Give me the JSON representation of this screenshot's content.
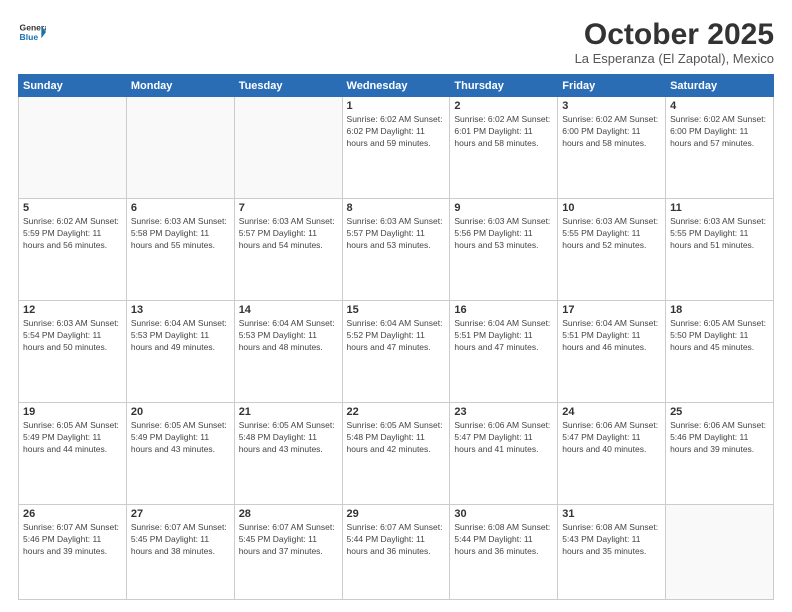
{
  "header": {
    "logo_line1": "General",
    "logo_line2": "Blue",
    "month": "October 2025",
    "location": "La Esperanza (El Zapotal), Mexico"
  },
  "days_of_week": [
    "Sunday",
    "Monday",
    "Tuesday",
    "Wednesday",
    "Thursday",
    "Friday",
    "Saturday"
  ],
  "weeks": [
    [
      {
        "day": "",
        "info": ""
      },
      {
        "day": "",
        "info": ""
      },
      {
        "day": "",
        "info": ""
      },
      {
        "day": "1",
        "info": "Sunrise: 6:02 AM\nSunset: 6:02 PM\nDaylight: 11 hours\nand 59 minutes."
      },
      {
        "day": "2",
        "info": "Sunrise: 6:02 AM\nSunset: 6:01 PM\nDaylight: 11 hours\nand 58 minutes."
      },
      {
        "day": "3",
        "info": "Sunrise: 6:02 AM\nSunset: 6:00 PM\nDaylight: 11 hours\nand 58 minutes."
      },
      {
        "day": "4",
        "info": "Sunrise: 6:02 AM\nSunset: 6:00 PM\nDaylight: 11 hours\nand 57 minutes."
      }
    ],
    [
      {
        "day": "5",
        "info": "Sunrise: 6:02 AM\nSunset: 5:59 PM\nDaylight: 11 hours\nand 56 minutes."
      },
      {
        "day": "6",
        "info": "Sunrise: 6:03 AM\nSunset: 5:58 PM\nDaylight: 11 hours\nand 55 minutes."
      },
      {
        "day": "7",
        "info": "Sunrise: 6:03 AM\nSunset: 5:57 PM\nDaylight: 11 hours\nand 54 minutes."
      },
      {
        "day": "8",
        "info": "Sunrise: 6:03 AM\nSunset: 5:57 PM\nDaylight: 11 hours\nand 53 minutes."
      },
      {
        "day": "9",
        "info": "Sunrise: 6:03 AM\nSunset: 5:56 PM\nDaylight: 11 hours\nand 53 minutes."
      },
      {
        "day": "10",
        "info": "Sunrise: 6:03 AM\nSunset: 5:55 PM\nDaylight: 11 hours\nand 52 minutes."
      },
      {
        "day": "11",
        "info": "Sunrise: 6:03 AM\nSunset: 5:55 PM\nDaylight: 11 hours\nand 51 minutes."
      }
    ],
    [
      {
        "day": "12",
        "info": "Sunrise: 6:03 AM\nSunset: 5:54 PM\nDaylight: 11 hours\nand 50 minutes."
      },
      {
        "day": "13",
        "info": "Sunrise: 6:04 AM\nSunset: 5:53 PM\nDaylight: 11 hours\nand 49 minutes."
      },
      {
        "day": "14",
        "info": "Sunrise: 6:04 AM\nSunset: 5:53 PM\nDaylight: 11 hours\nand 48 minutes."
      },
      {
        "day": "15",
        "info": "Sunrise: 6:04 AM\nSunset: 5:52 PM\nDaylight: 11 hours\nand 47 minutes."
      },
      {
        "day": "16",
        "info": "Sunrise: 6:04 AM\nSunset: 5:51 PM\nDaylight: 11 hours\nand 47 minutes."
      },
      {
        "day": "17",
        "info": "Sunrise: 6:04 AM\nSunset: 5:51 PM\nDaylight: 11 hours\nand 46 minutes."
      },
      {
        "day": "18",
        "info": "Sunrise: 6:05 AM\nSunset: 5:50 PM\nDaylight: 11 hours\nand 45 minutes."
      }
    ],
    [
      {
        "day": "19",
        "info": "Sunrise: 6:05 AM\nSunset: 5:49 PM\nDaylight: 11 hours\nand 44 minutes."
      },
      {
        "day": "20",
        "info": "Sunrise: 6:05 AM\nSunset: 5:49 PM\nDaylight: 11 hours\nand 43 minutes."
      },
      {
        "day": "21",
        "info": "Sunrise: 6:05 AM\nSunset: 5:48 PM\nDaylight: 11 hours\nand 43 minutes."
      },
      {
        "day": "22",
        "info": "Sunrise: 6:05 AM\nSunset: 5:48 PM\nDaylight: 11 hours\nand 42 minutes."
      },
      {
        "day": "23",
        "info": "Sunrise: 6:06 AM\nSunset: 5:47 PM\nDaylight: 11 hours\nand 41 minutes."
      },
      {
        "day": "24",
        "info": "Sunrise: 6:06 AM\nSunset: 5:47 PM\nDaylight: 11 hours\nand 40 minutes."
      },
      {
        "day": "25",
        "info": "Sunrise: 6:06 AM\nSunset: 5:46 PM\nDaylight: 11 hours\nand 39 minutes."
      }
    ],
    [
      {
        "day": "26",
        "info": "Sunrise: 6:07 AM\nSunset: 5:46 PM\nDaylight: 11 hours\nand 39 minutes."
      },
      {
        "day": "27",
        "info": "Sunrise: 6:07 AM\nSunset: 5:45 PM\nDaylight: 11 hours\nand 38 minutes."
      },
      {
        "day": "28",
        "info": "Sunrise: 6:07 AM\nSunset: 5:45 PM\nDaylight: 11 hours\nand 37 minutes."
      },
      {
        "day": "29",
        "info": "Sunrise: 6:07 AM\nSunset: 5:44 PM\nDaylight: 11 hours\nand 36 minutes."
      },
      {
        "day": "30",
        "info": "Sunrise: 6:08 AM\nSunset: 5:44 PM\nDaylight: 11 hours\nand 36 minutes."
      },
      {
        "day": "31",
        "info": "Sunrise: 6:08 AM\nSunset: 5:43 PM\nDaylight: 11 hours\nand 35 minutes."
      },
      {
        "day": "",
        "info": ""
      }
    ]
  ]
}
